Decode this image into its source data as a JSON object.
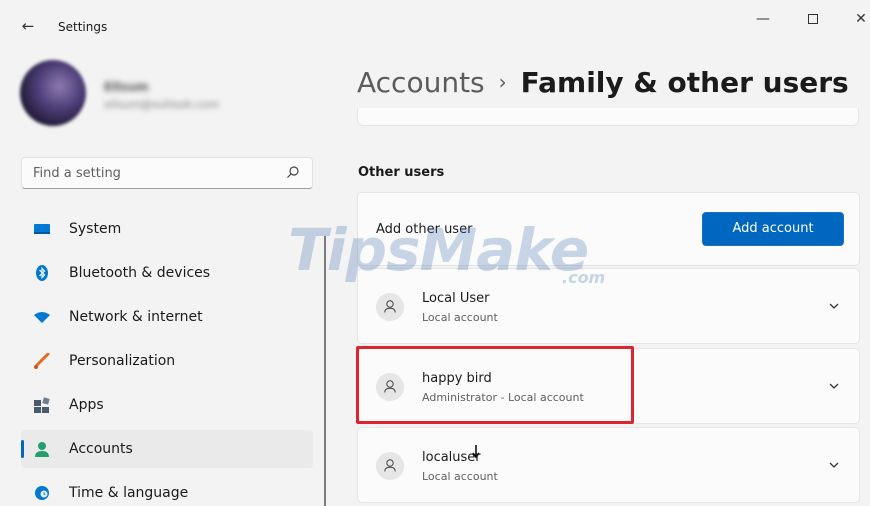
{
  "window": {
    "app_title": "Settings",
    "back_icon": "back-arrow-icon"
  },
  "profile": {
    "name": "Ellsum",
    "email": "ellsum@outlook.com"
  },
  "search": {
    "placeholder": "Find a setting",
    "icon": "search-icon"
  },
  "nav": {
    "items": [
      {
        "label": "System",
        "icon": "monitor-icon",
        "color": "#0078d4"
      },
      {
        "label": "Bluetooth & devices",
        "icon": "bluetooth-icon",
        "color": "#0078d4"
      },
      {
        "label": "Network & internet",
        "icon": "wifi-icon",
        "color": "#0078d4"
      },
      {
        "label": "Personalization",
        "icon": "brush-icon",
        "color": "#e56b22"
      },
      {
        "label": "Apps",
        "icon": "apps-icon",
        "color": "#4a5a6e"
      },
      {
        "label": "Accounts",
        "icon": "person-icon",
        "color": "#22a06b",
        "active": true
      },
      {
        "label": "Time & language",
        "icon": "globe-clock-icon",
        "color": "#0078d4"
      }
    ]
  },
  "breadcrumb": {
    "parent": "Accounts",
    "separator": "›",
    "current": "Family & other users"
  },
  "other_users": {
    "section_title": "Other users",
    "add_label": "Add other user",
    "add_button": "Add account",
    "users": [
      {
        "name": "Local User",
        "subtitle": "Local account"
      },
      {
        "name": "happy bird",
        "subtitle": "Administrator - Local account",
        "highlighted": true
      },
      {
        "name": "localuser",
        "subtitle": "Local account"
      }
    ]
  },
  "watermark": {
    "main": "TipsMake",
    "suffix": ".com"
  },
  "colors": {
    "accent": "#0067c0",
    "highlight": "#e0242f",
    "background": "#f3f3f3"
  }
}
